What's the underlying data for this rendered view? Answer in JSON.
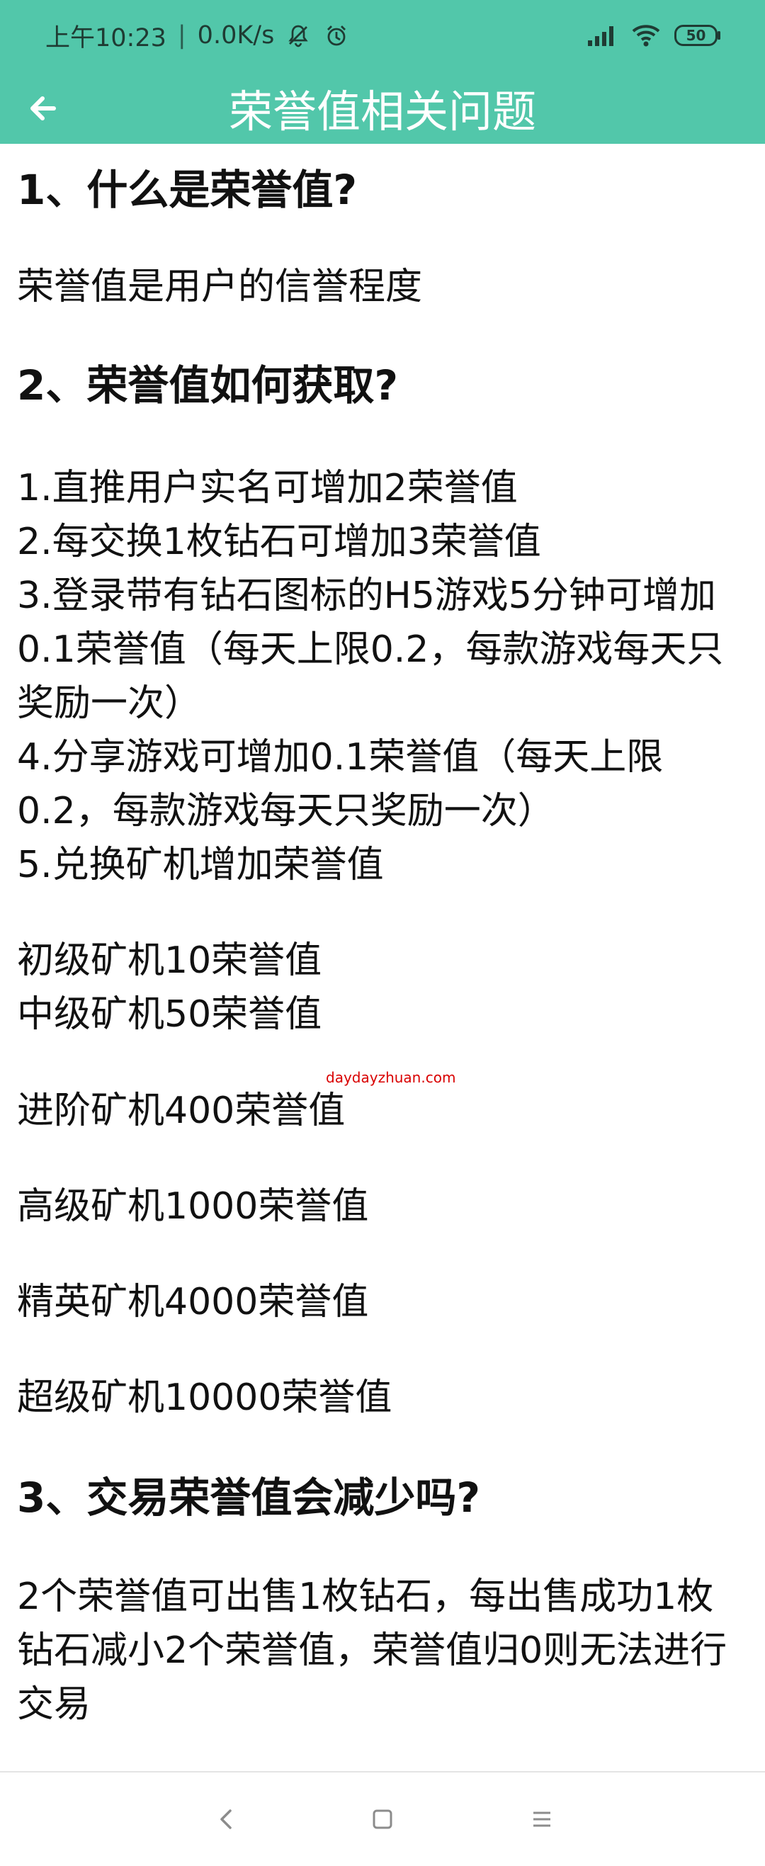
{
  "status_bar": {
    "time": "上午10:23",
    "separator": "|",
    "network_speed": "0.0K/s",
    "battery_level": "50",
    "icons": [
      "mute-bell-icon",
      "alarm-icon",
      "signal-icon",
      "wifi-icon",
      "battery-icon"
    ]
  },
  "app_bar": {
    "title": "荣誉值相关问题",
    "back_icon": "back-arrow-icon"
  },
  "content": {
    "q1": "1、什么是荣誉值?",
    "a1": "荣誉值是用户的信誉程度",
    "q2": "2、荣誉值如何获取?",
    "methods": [
      "1.直推用户实名可增加2荣誉值",
      "2.每交换1枚钻石可增加3荣誉值",
      "3.登录带有钻石图标的H5游戏5分钟可增加0.1荣誉值（每天上限0.2，每款游戏每天只奖励一次）",
      "4.分享游戏可增加0.1荣誉值（每天上限0.2，每款游戏每天只奖励一次）",
      "5.兑换矿机增加荣誉值"
    ],
    "miners": [
      "初级矿机10荣誉值",
      "中级矿机50荣誉值",
      "进阶矿机400荣誉值",
      "高级矿机1000荣誉值",
      "精英矿机4000荣誉值",
      "超级矿机10000荣誉值"
    ],
    "q3": "3、交易荣誉值会减少吗?",
    "a3": "2个荣誉值可出售1枚钻石，每出售成功1枚钻石减小2个荣誉值，荣誉值归0则无法进行交易",
    "watermark": "daydayzhuan.com"
  },
  "navigation_bar": {
    "icons": [
      "nav-back-icon",
      "nav-home-icon",
      "nav-menu-icon"
    ]
  },
  "colors": {
    "header": "#52c7aa",
    "header_text": "#ffffff",
    "body_text": "#111111",
    "watermark": "#d90000"
  }
}
